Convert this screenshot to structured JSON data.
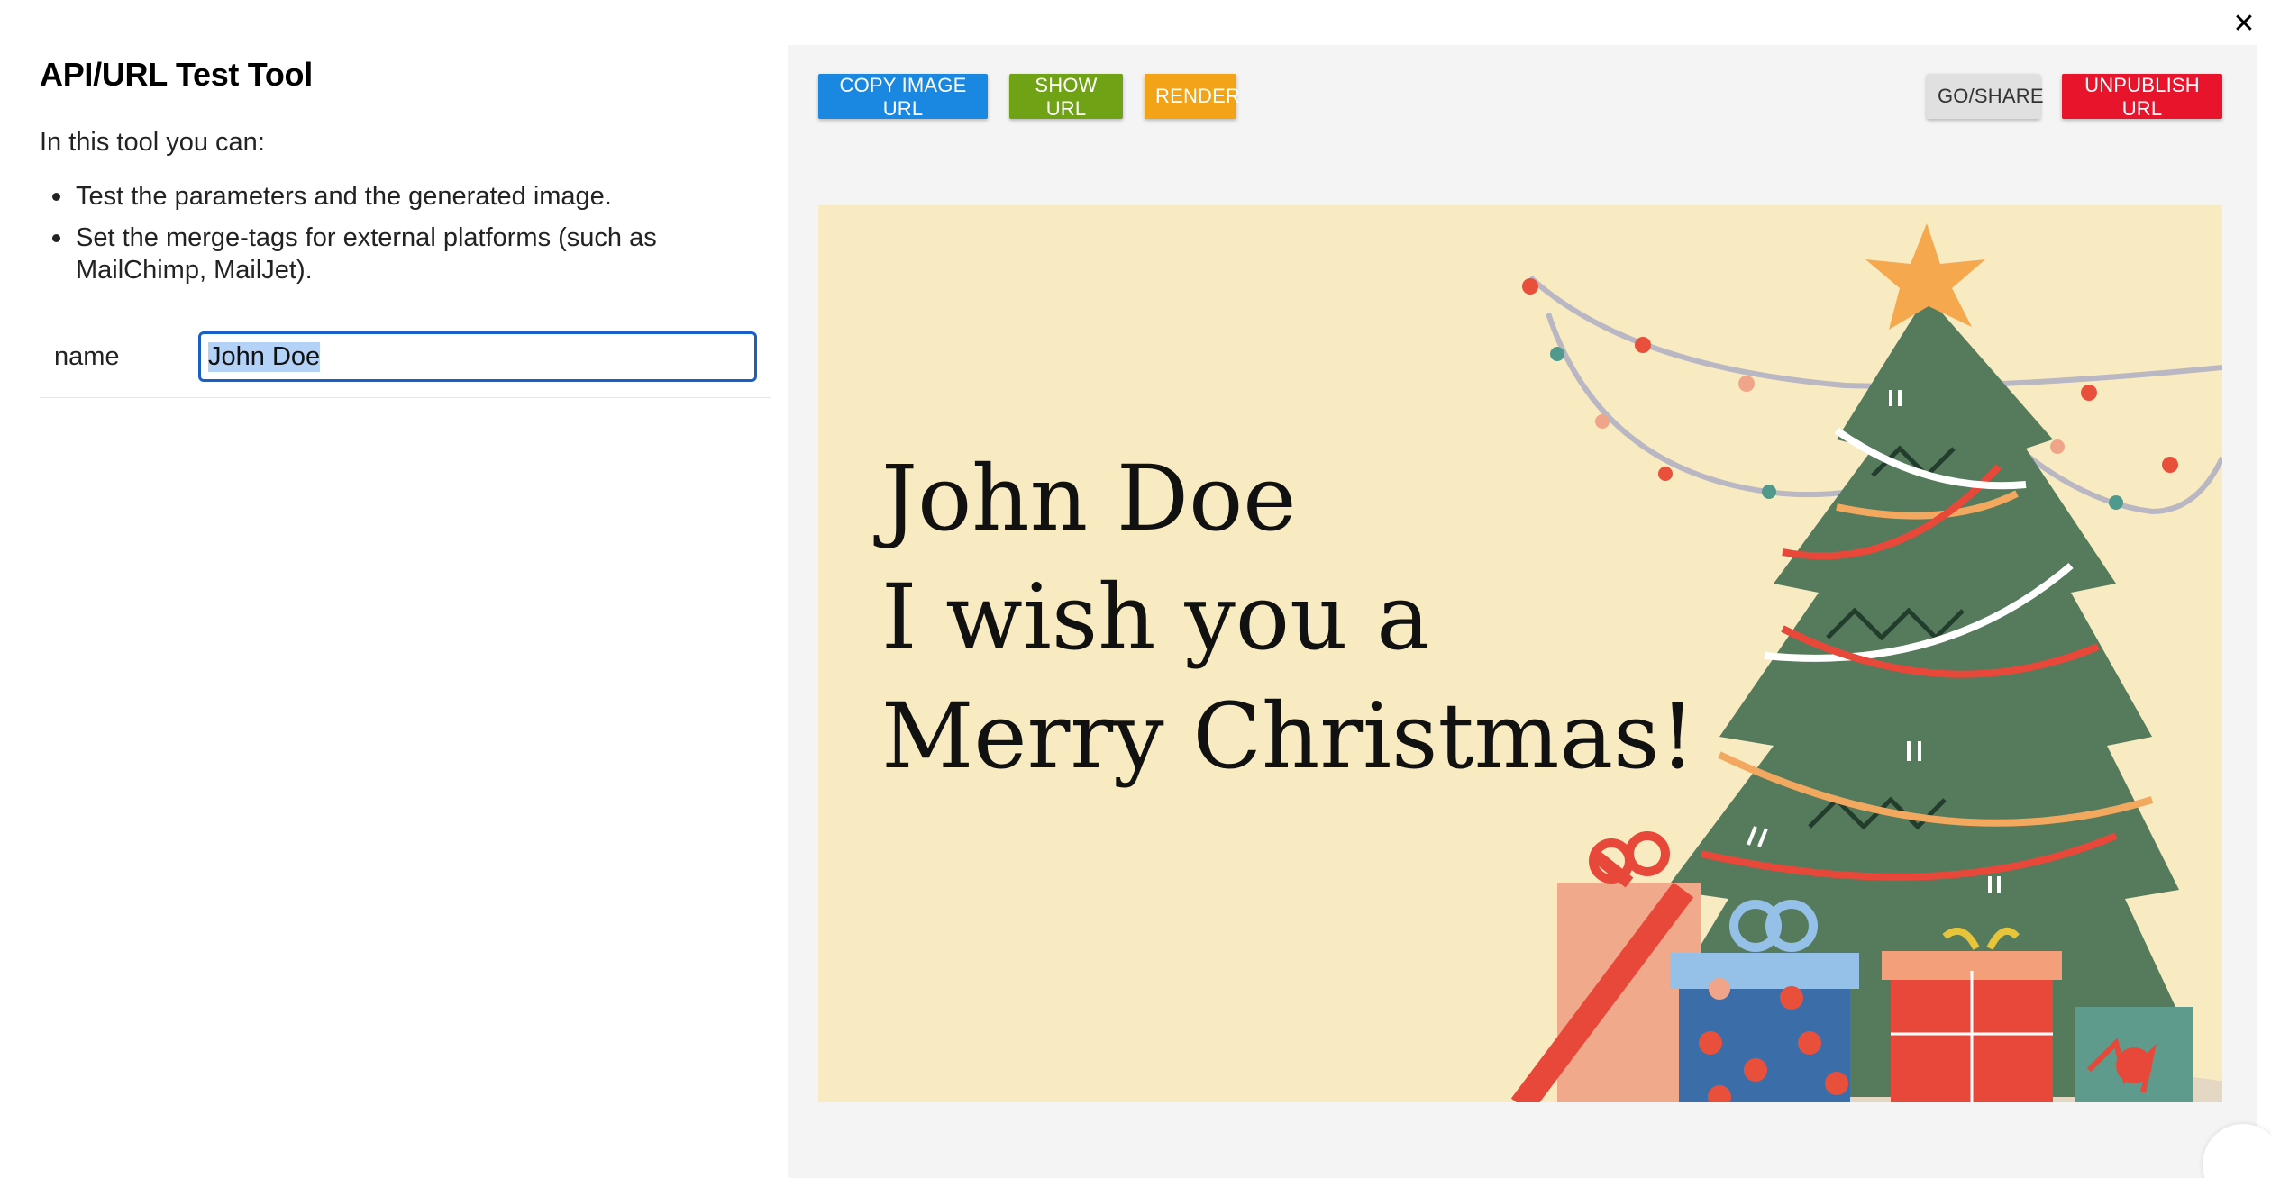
{
  "tool": {
    "title": "API/URL Test Tool",
    "intro": "In this tool you can:",
    "features": [
      "Test the parameters and the generated image.",
      "Set the merge-tags for external platforms (such as MailChimp, MailJet)."
    ]
  },
  "params": {
    "name_label": "name",
    "name_value": "John Doe"
  },
  "toolbar": {
    "copy_image_url": "COPY IMAGE URL",
    "show_url": "SHOW URL",
    "render": "RENDER",
    "go_share": "GO/SHARE",
    "unpublish_url": "UNPUBLISH URL"
  },
  "preview": {
    "line1": "John Doe",
    "line2": "I wish you a",
    "line3": "Merry Christmas!"
  },
  "colors": {
    "copy": "#1a87e0",
    "show": "#6fa214",
    "render": "#f3a317",
    "go_share": "#e0e0e0",
    "unpublish": "#e8142c",
    "card_bg": "#f8ebc2",
    "input_focus": "#1a5fc8"
  }
}
